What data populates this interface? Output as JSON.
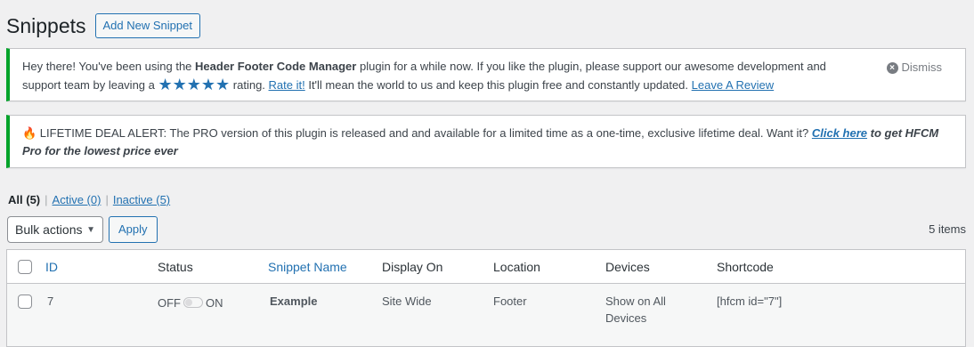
{
  "page": {
    "title": "Snippets",
    "add_new_label": "Add New Snippet"
  },
  "notice_review": {
    "text_before": "Hey there! You've been using the ",
    "plugin_name": "Header Footer Code Manager",
    "text_mid": " plugin for a while now. If you like the plugin, please support our awesome development and support team by leaving a ",
    "stars": "★★★★★",
    "text_rating": " rating. ",
    "rate_link": "Rate it!",
    "text_after": " It'll mean the world to us and keep this plugin free and constantly updated. ",
    "review_link": "Leave A Review",
    "dismiss_label": "Dismiss"
  },
  "notice_deal": {
    "fire": "🔥",
    "text": " LIFETIME DEAL ALERT: The PRO version of this plugin is released and and available for a limited time as a one-time, exclusive lifetime deal. Want it? ",
    "link": "Click here",
    "tail": " to get HFCM Pro for the lowest price ever"
  },
  "filters": {
    "all": "All",
    "all_count": "(5)",
    "active": "Active (0)",
    "inactive": "Inactive (5)",
    "sep": "|"
  },
  "tablenav": {
    "bulk_label": "Bulk actions",
    "apply_label": "Apply",
    "items_count": "5 items"
  },
  "table": {
    "columns": [
      "ID",
      "Status",
      "Snippet Name",
      "Display On",
      "Location",
      "Devices",
      "Shortcode"
    ],
    "rows": [
      {
        "id": "7",
        "status_off": "OFF",
        "status_on": "ON",
        "name": "Example",
        "display_on": "Site Wide",
        "location": "Footer",
        "devices_line1": "Show on All",
        "devices_line2": "Devices",
        "shortcode": "[hfcm id=\"7\"]"
      }
    ]
  }
}
